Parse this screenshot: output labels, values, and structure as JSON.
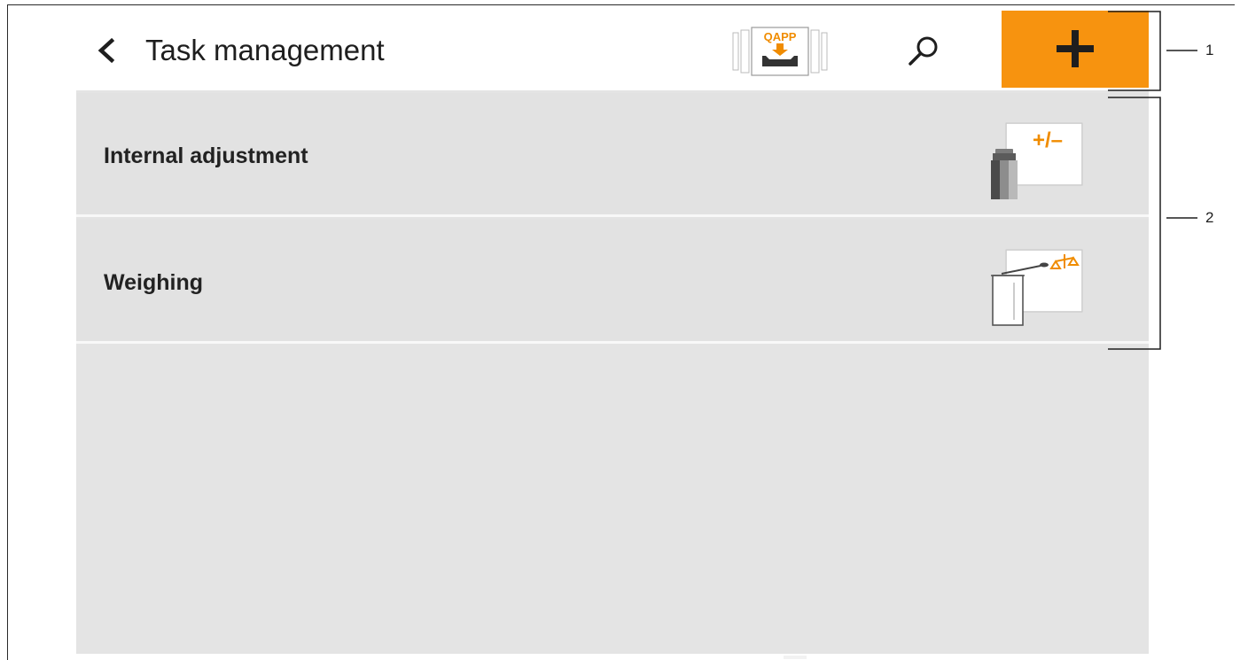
{
  "header": {
    "title": "Task management",
    "back_icon": "chevron-left-icon",
    "qapp_label": "QAPP",
    "qapp_icon": "qapp-import-icon",
    "search_icon": "magnifier-icon",
    "add_icon": "plus-icon"
  },
  "tasks": [
    {
      "label": "Internal adjustment",
      "icon": "internal-adjustment-icon",
      "icon_text": "+/–"
    },
    {
      "label": "Weighing",
      "icon": "weighing-icon"
    }
  ],
  "callouts": {
    "header": "1",
    "task_list": "2"
  },
  "colors": {
    "accent": "#f7930f",
    "header_background": "#ffffff",
    "list_background": "#e2e2e2",
    "text": "#1e1e1e"
  }
}
